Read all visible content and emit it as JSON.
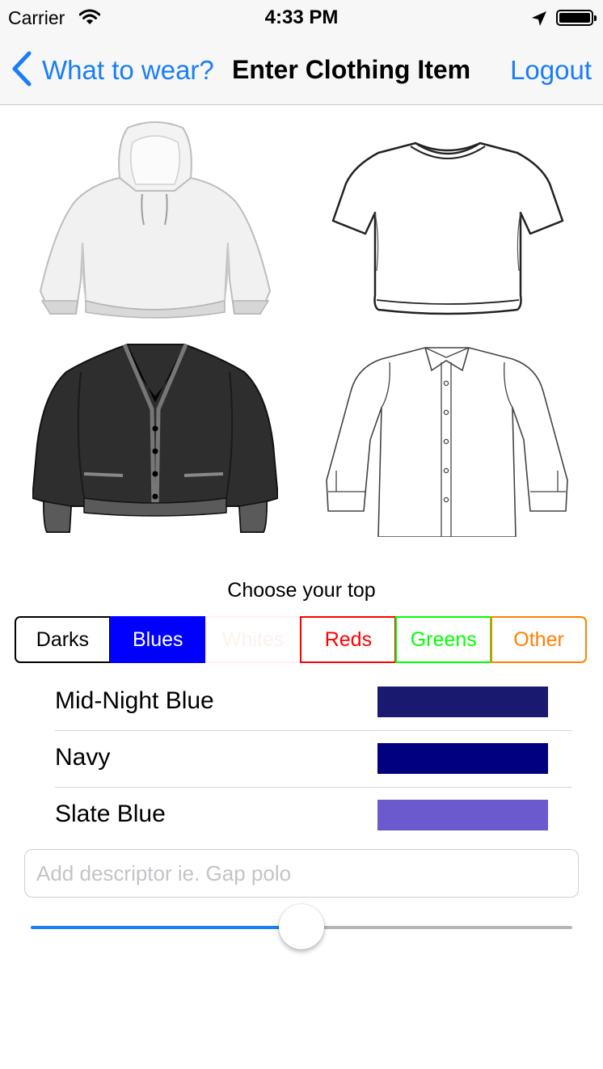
{
  "status_bar": {
    "carrier": "Carrier",
    "time": "4:33 PM"
  },
  "nav": {
    "back_label": "What to wear?",
    "title": "Enter Clothing Item",
    "right_label": "Logout",
    "tint": "#1a7ef7"
  },
  "garments": [
    {
      "name": "hoodie",
      "icon": "hoodie-icon"
    },
    {
      "name": "t-shirt",
      "icon": "tshirt-icon"
    },
    {
      "name": "cardigan",
      "icon": "cardigan-icon"
    },
    {
      "name": "button-shirt",
      "icon": "button-shirt-icon"
    }
  ],
  "prompt": "Choose your top",
  "segments": [
    {
      "label": "Darks",
      "color": "#000000",
      "selected": false
    },
    {
      "label": "Blues",
      "color": "#0000ff",
      "selected": true
    },
    {
      "label": "Whites",
      "color": "#fff0ef",
      "selected": false
    },
    {
      "label": "Reds",
      "color": "#ff0000",
      "selected": false
    },
    {
      "label": "Greens",
      "color": "#00ff00",
      "selected": false
    },
    {
      "label": "Other",
      "color": "#ff8000",
      "selected": false
    }
  ],
  "colors": [
    {
      "label": "Mid-Night Blue",
      "swatch": "#191970"
    },
    {
      "label": "Navy",
      "swatch": "#000080"
    },
    {
      "label": "Slate Blue",
      "swatch": "#6a5acd"
    }
  ],
  "descriptor": {
    "placeholder": "Add descriptor ie. Gap polo",
    "value": ""
  },
  "slider": {
    "value": 0.5
  }
}
